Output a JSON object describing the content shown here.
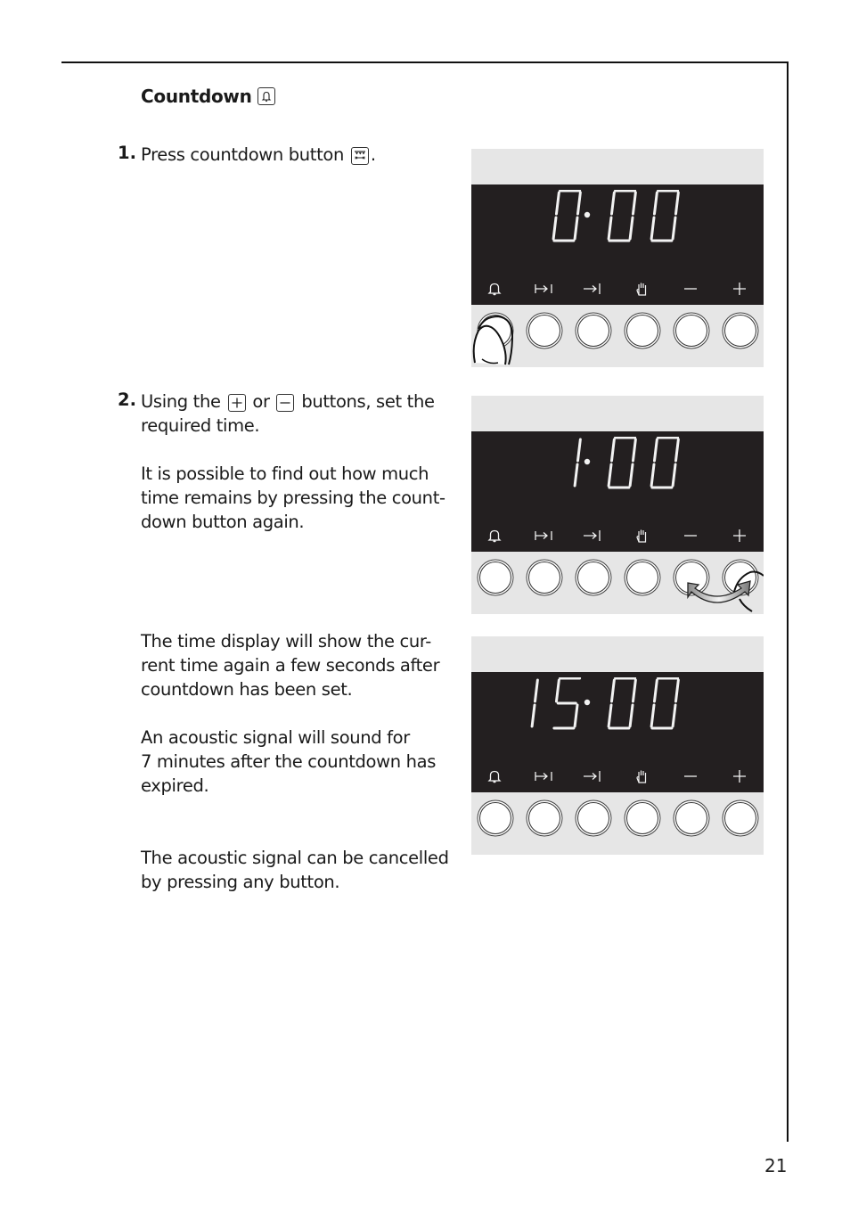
{
  "page": {
    "number": "21"
  },
  "section": {
    "title": "Countdown",
    "title_icon": "bell-icon"
  },
  "steps": [
    {
      "number": "1.",
      "text_before": "Press countdown button",
      "icon": "countdown-button-icon",
      "text_after": "."
    },
    {
      "number": "2.",
      "line1_a": "Using the",
      "icon_plus": "plus-button-icon",
      "line1_b": "or",
      "icon_minus": "minus-button-icon",
      "line1_c": "buttons, set the",
      "line2": "required time.",
      "note_lines": [
        "It is possible to find out how much",
        "time remains by pressing the count-",
        "down button again."
      ]
    }
  ],
  "paragraphs": [
    {
      "lines": [
        "The time display will show the cur-",
        "rent time again a few seconds after",
        "countdown has been set."
      ]
    },
    {
      "lines": [
        "An acoustic signal will sound for",
        "7 minutes after the countdown has",
        "expired."
      ]
    },
    {
      "lines": [
        "The acoustic signal can be cancelled",
        "by pressing any button."
      ]
    }
  ],
  "panels": [
    {
      "display": "0·00",
      "hours": "0",
      "minutes": "00",
      "annotation": "finger pressing countdown button"
    },
    {
      "display": "1·00",
      "hours": "1",
      "minutes": "00",
      "annotation": "finger toggling minus/plus buttons"
    },
    {
      "display": "15·00",
      "hours": "15",
      "minutes": "00",
      "annotation": "none"
    }
  ],
  "panel_labels": [
    {
      "name": "countdown",
      "icon": "bell-icon"
    },
    {
      "name": "duration",
      "icon": "duration-arrow-icon"
    },
    {
      "name": "end-time",
      "icon": "end-arrow-icon"
    },
    {
      "name": "manual",
      "icon": "hand-icon"
    },
    {
      "name": "minus",
      "icon": "minus-icon"
    },
    {
      "name": "plus",
      "icon": "plus-icon"
    }
  ],
  "colors": {
    "display_bg": "#231f20",
    "panel_bg": "#e6e6e6",
    "segment": "#f2f2f2"
  }
}
